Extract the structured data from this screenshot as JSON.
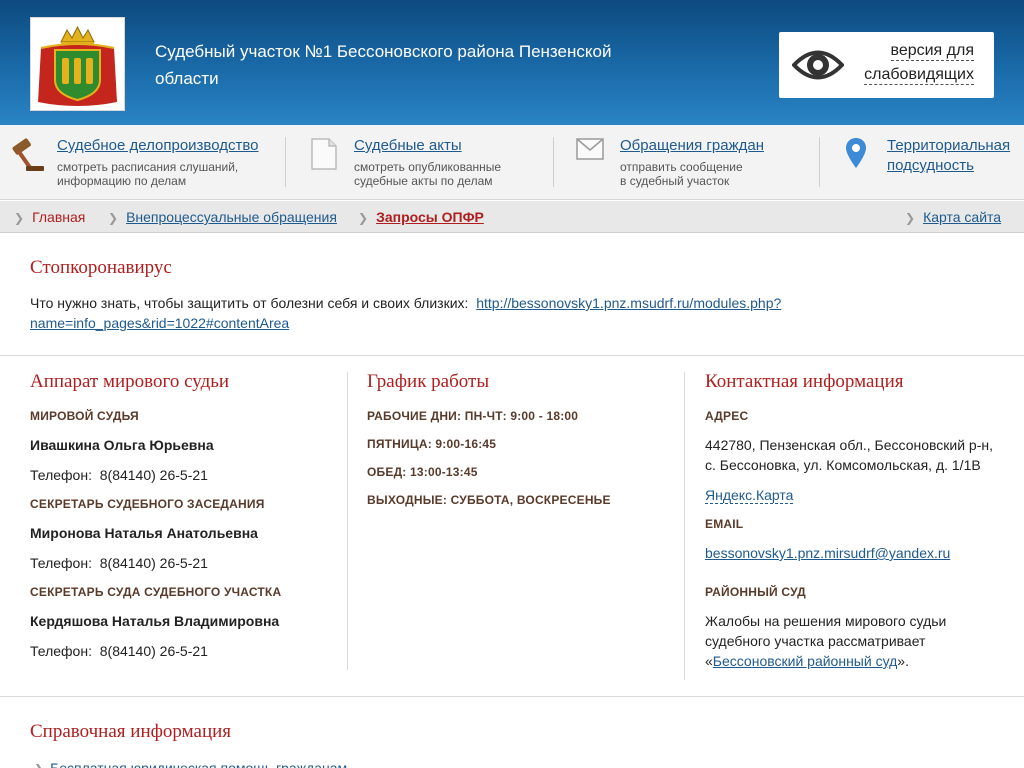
{
  "header": {
    "title": "Судебный участок №1 Бессоновского района Пензенской области",
    "vision_label_line1": "версия для",
    "vision_label_line2": "слабовидящих",
    "logo_icon": "coat-of-arms-icon",
    "vision_icon": "eye-icon"
  },
  "nav": [
    {
      "label": "Судебное делопроизводство",
      "desc_line1": "смотреть расписания слушаний,",
      "desc_line2": "информацию по делам",
      "icon": "gavel-icon"
    },
    {
      "label": "Судебные акты",
      "desc_line1": "смотреть опубликованные",
      "desc_line2": "судебные акты по делам",
      "icon": "document-icon"
    },
    {
      "label": "Обращения граждан",
      "desc_line1": "отправить сообщение",
      "desc_line2": "в судебный участок",
      "icon": "envelope-icon"
    },
    {
      "label_line1": "Территориальная",
      "label_line2": "подсудность",
      "icon": "map-pin-icon"
    }
  ],
  "breadcrumb": {
    "home": "Главная",
    "section": "Внепроцессуальные обращения",
    "current": "Запросы ОПФР",
    "sitemap": "Карта сайта"
  },
  "notice": {
    "title": "Стопкоронавирус",
    "text": "Что нужно знать, чтобы защитить от болезни себя и своих близких:",
    "link_line1": "http://bessonovsky1.pnz.msudrf.ru/modules.php?",
    "link_line2": "name=info_pages&rid=1022#contentArea"
  },
  "staff": {
    "title": "Аппарат мирового судьи",
    "phone_prefix": "Телефон:",
    "people": [
      {
        "role": "МИРОВОЙ СУДЬЯ",
        "name": "Ивашкина Ольга Юрьевна",
        "phone": "8(84140) 26-5-21"
      },
      {
        "role": "СЕКРЕТАРЬ СУДЕБНОГО ЗАСЕДАНИЯ",
        "name": "Миронова Наталья Анатольевна",
        "phone": "8(84140) 26-5-21"
      },
      {
        "role": "СЕКРЕТАРЬ СУДА СУДЕБНОГО УЧАСТКА",
        "name": "Кердяшова Наталья Владимировна",
        "phone": "8(84140) 26-5-21"
      }
    ]
  },
  "schedule": {
    "title": "График работы",
    "rows": [
      "РАБОЧИЕ ДНИ: ПН-ЧТ: 9:00 - 18:00",
      "ПЯТНИЦА: 9:00-16:45",
      "ОБЕД: 13:00-13:45",
      "ВЫХОДНЫЕ: СУББОТА, ВОСКРЕСЕНЬЕ"
    ]
  },
  "contacts": {
    "title": "Контактная информация",
    "address_label": "АДРЕС",
    "address_line1": "442780, Пензенская обл., Бессоновский р-н,",
    "address_line2": "с. Бессоновка, ул. Комсомольская, д. 1/1В",
    "map_link": "Яндекс.Карта",
    "email_label": "EMAIL",
    "email": "bessonovsky1.pnz.mirsudrf@yandex.ru",
    "court_label": "РАЙОННЫЙ СУД",
    "court_text_line1": "Жалобы на решения мирового судьи",
    "court_text_line2": "судебного участка рассматривает",
    "court_quote_open": "«",
    "court_link": "Бессоновский районный суд",
    "court_quote_close": "»."
  },
  "reference": {
    "title": "Справочная информация",
    "first_item": "Бесплатная юридическая помощь гражданам"
  }
}
